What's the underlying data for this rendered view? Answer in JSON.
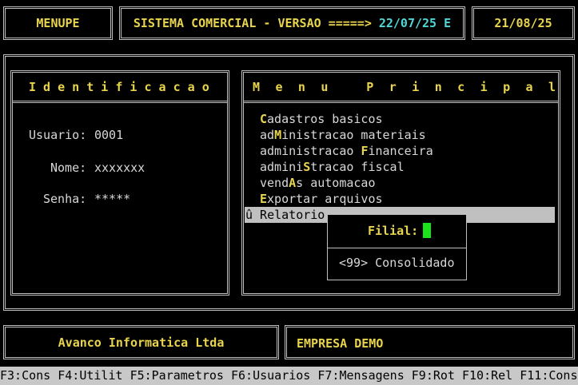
{
  "header": {
    "program_name": "MENUPE",
    "system_title": "SISTEMA COMERCIAL - VERSAO =====>",
    "version_date": "22/07/25 E",
    "current_date": "21/08/25"
  },
  "identification": {
    "title": "I d e n t i f i c a c a o",
    "user_label": "Usuario:",
    "user_value": "0001",
    "name_label": "Nome:",
    "name_value": "xxxxxxx",
    "password_label": "Senha:",
    "password_value": "*****"
  },
  "main_menu": {
    "title": "M e n u   P r i n c i p a l",
    "items": [
      {
        "pre": "",
        "hot": "C",
        "post": "adastros basicos"
      },
      {
        "pre": "ad",
        "hot": "M",
        "post": "inistracao materiais"
      },
      {
        "pre": "administracao ",
        "hot": "F",
        "post": "inanceira"
      },
      {
        "pre": "admini",
        "hot": "S",
        "post": "tracao fiscal"
      },
      {
        "pre": "vend",
        "hot": "A",
        "post": "s automacao"
      },
      {
        "pre": "",
        "hot": "E",
        "post": "xportar arquivos"
      }
    ],
    "selected_item": "û Relatorio"
  },
  "filial_popup": {
    "label": "Filial:",
    "option": "<99> Consolidado"
  },
  "footer": {
    "company": "Avanco Informatica Ltda",
    "client": "EMPRESA DEMO"
  },
  "function_keys": [
    "F3:Cons",
    "F4:Utilit",
    "F5:Parametros",
    "F6:Usuarios",
    "F7:Mensagens",
    "F9:Rot",
    "F10:Rel",
    "F11:Cons"
  ],
  "colors": {
    "background": "#000000",
    "label_yellow": "#e8d44d",
    "version_cyan": "#4fd6d6",
    "cursor_green": "#19e319",
    "status_bar": "#c8c8c8",
    "selection": "#c0c0c0"
  }
}
